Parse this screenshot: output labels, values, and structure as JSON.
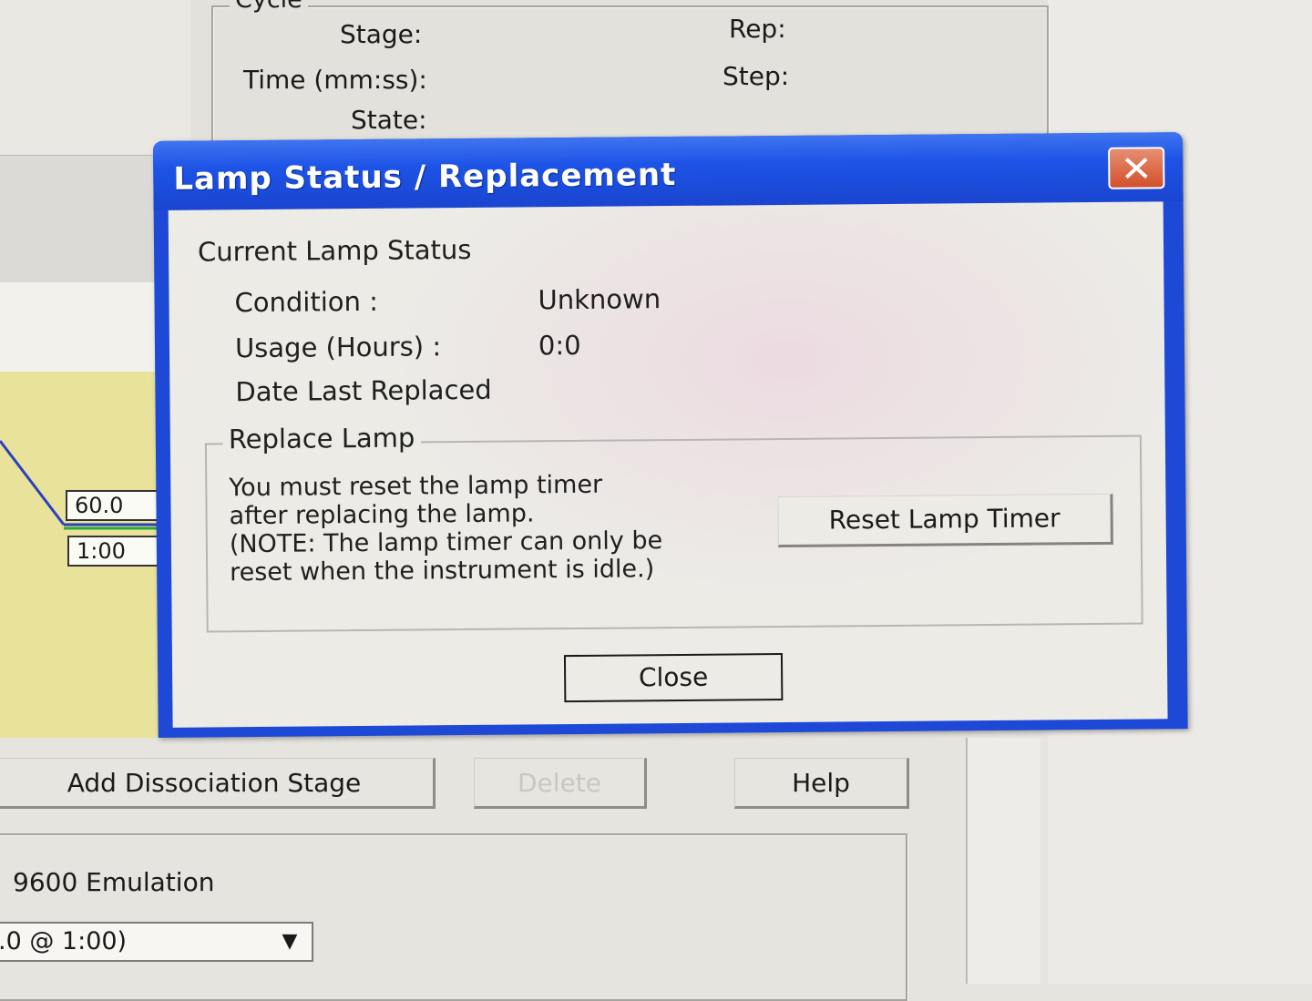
{
  "background_window": {
    "cycle_group": {
      "legend": "Cycle",
      "stage_label": "Stage:",
      "time_label": "Time (mm:ss):",
      "state_label": "State:",
      "rep_label": "Rep:",
      "step_label": "Step:"
    },
    "plot": {
      "temperature_value": "60.0",
      "time_value": "1:00"
    },
    "buttons": {
      "add_dissociation_stage": "Add Dissociation Stage",
      "delete": "Delete",
      "help": "Help"
    },
    "emulation": {
      "label": "9600 Emulation",
      "select_value": ".0 @ 1:00)"
    }
  },
  "dialog": {
    "title": "Lamp Status / Replacement",
    "current_status": {
      "heading": "Current Lamp Status",
      "condition_label": "Condition :",
      "condition_value": "Unknown",
      "usage_label": "Usage (Hours) :",
      "usage_value": "0:0",
      "date_replaced_label": "Date Last Replaced"
    },
    "replace_lamp": {
      "legend": "Replace Lamp",
      "note_lines": [
        "You must reset the lamp timer",
        "after replacing the lamp.",
        "(NOTE: The lamp timer can only be",
        "reset when the instrument is idle.)"
      ],
      "reset_button": "Reset Lamp Timer"
    },
    "close_button": "Close"
  },
  "colors": {
    "titlebar_blue": "#1d49d6",
    "close_x_red": "#d2502c",
    "plot_yellow": "#e8e29b",
    "plot_line_blue": "#2b3fbf",
    "plot_line_green": "#2fa83a"
  },
  "icons": {
    "title_close": "close-x-icon",
    "dropdown": "chevron-down-icon"
  }
}
